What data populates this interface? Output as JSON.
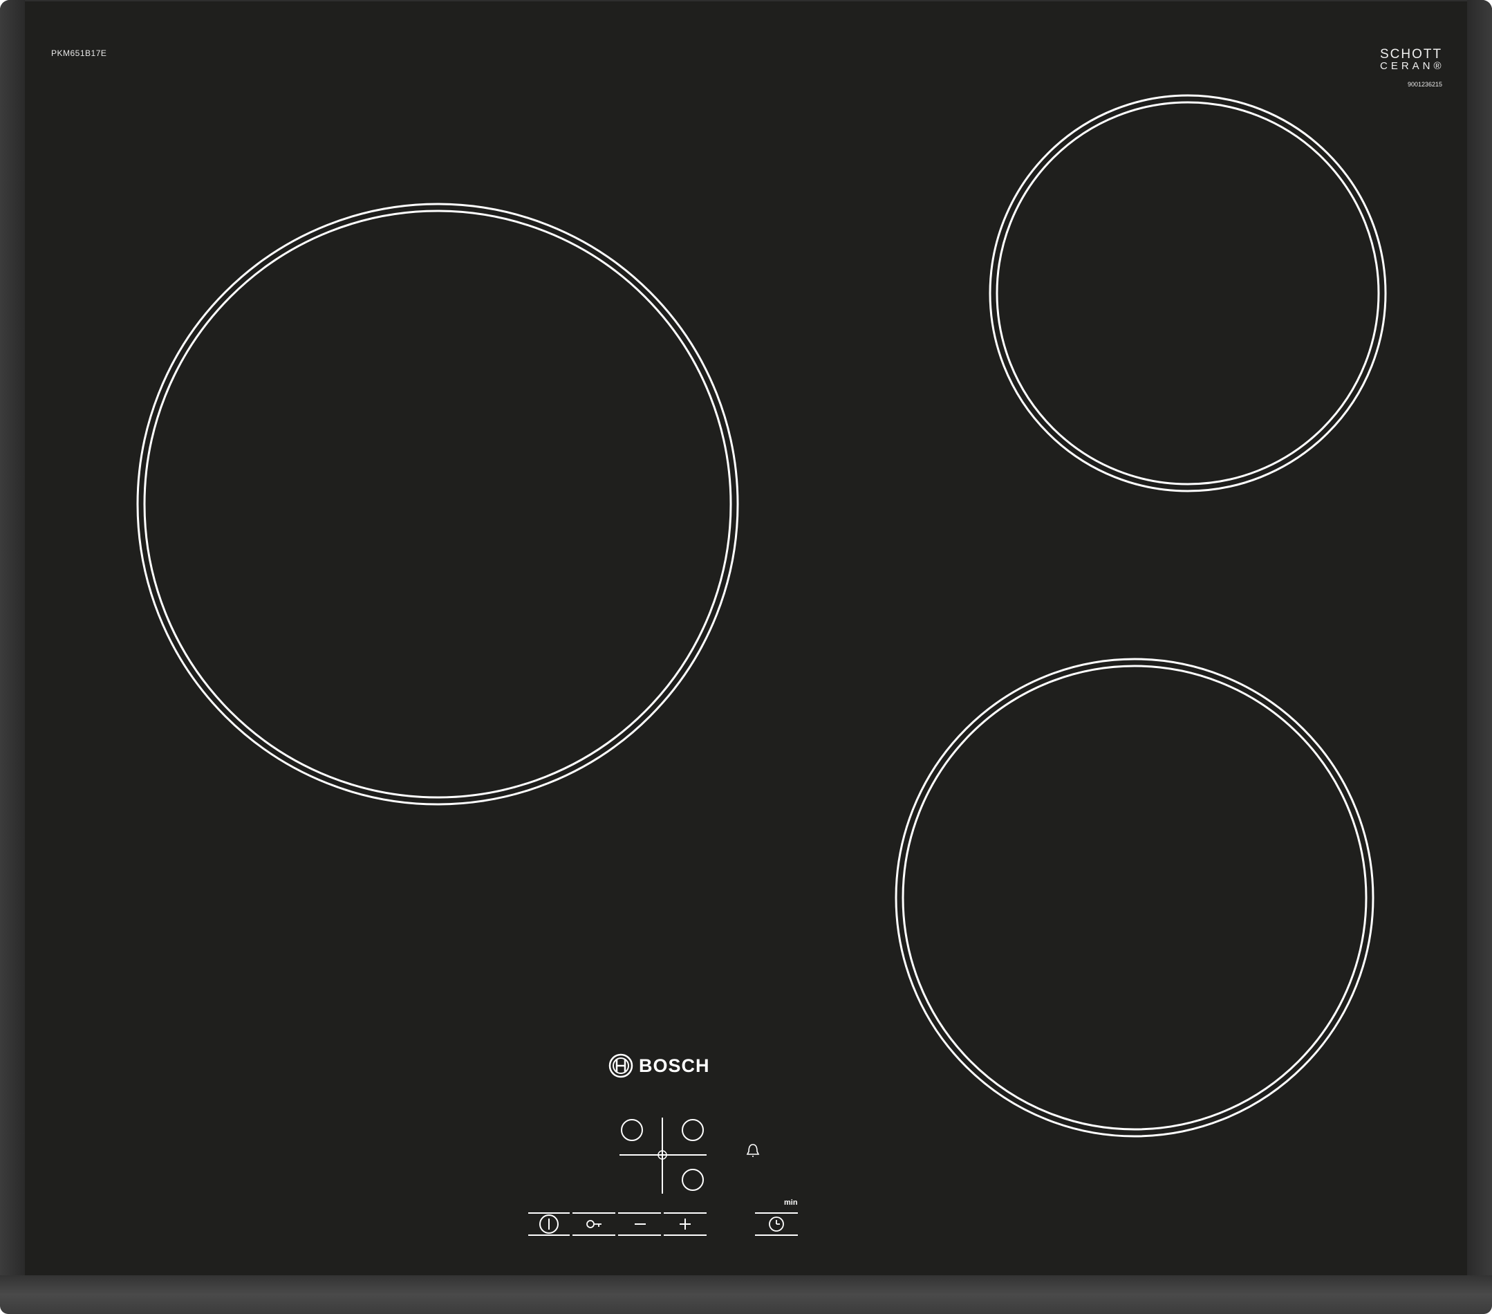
{
  "product": {
    "model_code": "PKM651B17E",
    "glass_brand_line1": "SCHOTT",
    "glass_brand_line2": "CERAN®",
    "serial": "9001236215",
    "brand": "BOSCH"
  },
  "cooking_zones": [
    {
      "name": "front-left-large"
    },
    {
      "name": "rear-right-small"
    },
    {
      "name": "front-right-medium"
    }
  ],
  "controls": {
    "power_icon": "power-icon",
    "lock_icon": "key-lock-icon",
    "minus_icon": "minus-icon",
    "plus_icon": "plus-icon",
    "timer_icon": "clock-icon",
    "alarm_icon": "bell-icon",
    "timer_unit_label": "min"
  },
  "colors": {
    "glass": "#1f1f1d",
    "markings": "#ffffff",
    "frame": "#2e2e2e"
  }
}
